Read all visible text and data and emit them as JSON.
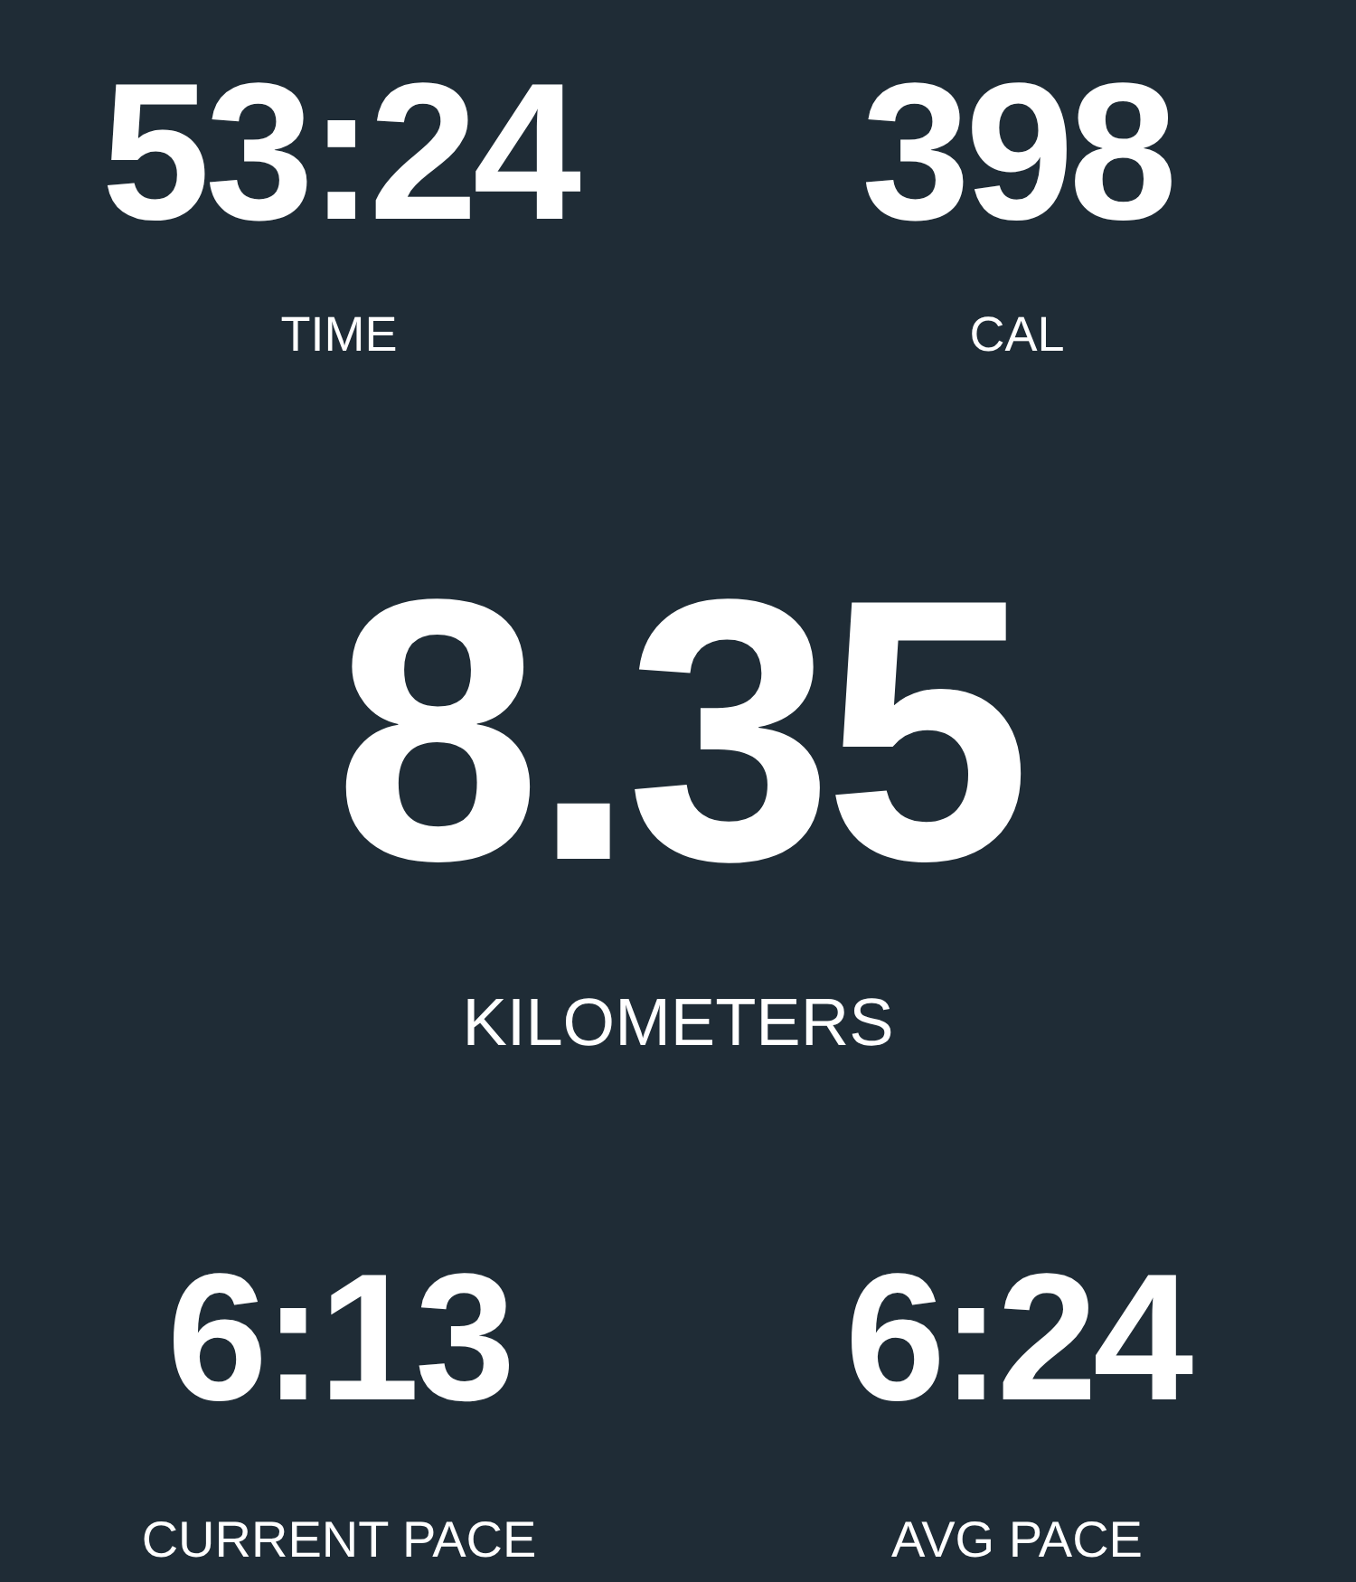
{
  "top_stats": [
    {
      "value": "53:24",
      "label": "TIME"
    },
    {
      "value": "398",
      "label": "CAL"
    }
  ],
  "main_stat": {
    "value": "8.35",
    "label": "KILOMETERS"
  },
  "bottom_stats": [
    {
      "value": "6:13",
      "label": "CURRENT PACE"
    },
    {
      "value": "6:24",
      "label": "AVG PACE"
    }
  ]
}
